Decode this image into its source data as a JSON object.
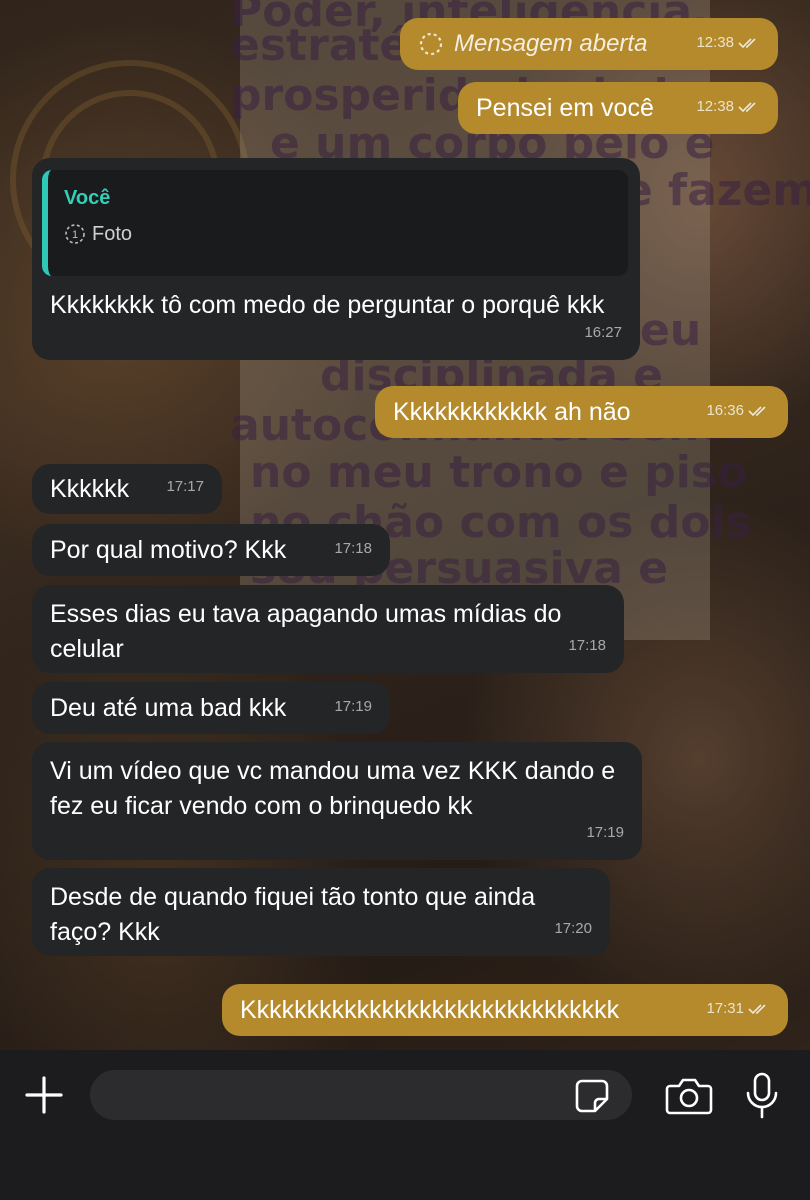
{
  "wallpaper": {
    "lines": [
      "Poder, inteligência,",
      "estratégia,",
      "prosperidade, beleza",
      "e um corpo belo e",
      "que fazem",
      "eu",
      "disciplinada e",
      "autoconfiante. Sento",
      "no meu trono e piso",
      "no chão com os dois",
      "sou persuasiva e"
    ]
  },
  "messages": [
    {
      "id": "m1",
      "direction": "out",
      "text": "Mensagem aberta",
      "time": "12:38",
      "view_once": true
    },
    {
      "id": "m2",
      "direction": "out",
      "text": "Pensei em você",
      "time": "12:38"
    },
    {
      "id": "m3",
      "direction": "in",
      "quote_author": "Você",
      "quote_text": "Foto",
      "text": "Kkkkkkkk tô com medo de perguntar o porquê kkk",
      "time": "16:27"
    },
    {
      "id": "m4",
      "direction": "out",
      "text": "Kkkkkkkkkkkk ah não",
      "time": "16:36"
    },
    {
      "id": "m5",
      "direction": "in",
      "text": "Kkkkkk",
      "time": "17:17"
    },
    {
      "id": "m6",
      "direction": "in",
      "text": "Por qual motivo? Kkk",
      "time": "17:18"
    },
    {
      "id": "m7",
      "direction": "in",
      "text": "Esses dias eu tava apagando umas mídias do celular",
      "time": "17:18"
    },
    {
      "id": "m8",
      "direction": "in",
      "text": "Deu até uma bad kkk",
      "time": "17:19"
    },
    {
      "id": "m9",
      "direction": "in",
      "text": "Vi um vídeo que vc mandou uma vez KKK dando e fez eu ficar vendo com o brinquedo kk",
      "time": "17:19"
    },
    {
      "id": "m10",
      "direction": "in",
      "text": "Desde de quando fiquei tão tonto que ainda faço? Kkk",
      "time": "17:20"
    },
    {
      "id": "m11",
      "direction": "out",
      "text": "Kkkkkkkkkkkkkkkkkkkkkkkkkkkkkk",
      "time": "17:31"
    }
  ],
  "composer": {
    "placeholder": "",
    "icons": [
      "plus-icon",
      "sticker-icon",
      "camera-icon",
      "microphone-icon"
    ]
  },
  "colors": {
    "incoming_bubble": "#232527",
    "outgoing_bubble": "#b58a2d",
    "quote_accent": "#2fc9b7",
    "bottom_bar": "#1c1c1e"
  }
}
